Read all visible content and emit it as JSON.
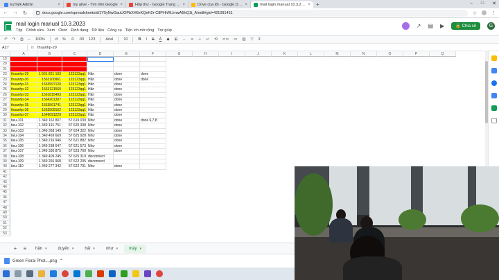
{
  "browser": {
    "tabs": [
      {
        "label": "EzTalk Admin",
        "color": "#4285f4"
      },
      {
        "label": "my alive - Tìm trên Google",
        "color": "#ea4335"
      },
      {
        "label": "Hộp thư - Google Trang tính",
        "color": "#ea4335"
      },
      {
        "label": "Drive của tôi - Google Drive",
        "color": "#fbbc04"
      },
      {
        "label": "mail login manual 10.3.2023 - Go",
        "color": "#0f9d58",
        "active": true
      }
    ],
    "url": "docs.google.com/spreadsheets/d/1Y5yNwGauUOPbXH6xKQeH2r-C8PHhRLlmwA5hQ1t_A/edit#gid=421091451"
  },
  "sheets": {
    "title": "mail login manual 10.3.2023",
    "menus": [
      "Tệp",
      "Chỉnh sửa",
      "Xem",
      "Chèn",
      "Định dạng",
      "Dữ liệu",
      "Công cụ",
      "Tiện ích mở rộng",
      "Trợ giúp"
    ],
    "share_label": "Chia sẻ",
    "account_initial": "G",
    "toolbar": {
      "zoom": "100%",
      "currency": "đ",
      "percent": "%",
      "decimal_less": ".0",
      "decimal_more": ".00",
      "number_format": "123",
      "font": "Arial",
      "font_size": "10"
    },
    "name_box": "A27",
    "formula": "thuanhp-29"
  },
  "grid": {
    "columns": [
      "A",
      "B",
      "C",
      "D",
      "E",
      "F",
      "G",
      "H",
      "I",
      "J",
      "K",
      "L",
      "M",
      "N",
      "O",
      "P",
      "Q"
    ],
    "rows": [
      {
        "n": "19",
        "cells": [
          "",
          "",
          "",
          "",
          "",
          ""
        ],
        "fill": [
          "#ff0000",
          "#ff0000",
          "#ff0000"
        ]
      },
      {
        "n": "20",
        "cells": [
          "",
          "",
          "",
          "",
          "",
          ""
        ],
        "fill": [
          "#ff0000",
          "#ff0000",
          "#ff0000"
        ]
      },
      {
        "n": "21",
        "cells": [
          "",
          "",
          "",
          "",
          "",
          ""
        ],
        "fill": [
          "#ff0000",
          "#ff0000",
          "#ff0000"
        ]
      },
      {
        "n": "22",
        "cells": [
          "thuanhp-29",
          "1 561 821 103",
          "123123qq1",
          "Hân",
          "done",
          "done"
        ],
        "fill": [
          "#ffff00",
          "#ffff00",
          "#ffff00"
        ]
      },
      {
        "n": "23",
        "cells": [
          "thuanhp-30",
          "1563100961",
          "123123qq1",
          "Hân",
          "done",
          "done"
        ],
        "fill": [
          "#ffff00",
          "#ffff00",
          "#ffff00"
        ]
      },
      {
        "n": "24",
        "cells": [
          "thuanhp-31",
          "1563597120",
          "123123qq1",
          "Hân",
          "done",
          ""
        ],
        "fill": [
          "#ffff00",
          "#ffff00",
          "#ffff00"
        ]
      },
      {
        "n": "25",
        "cells": [
          "thuanhp-32",
          "1563121560",
          "123123qq1",
          "Hân",
          "done",
          ""
        ],
        "fill": [
          "#ffff00",
          "#ffff00",
          "#ffff00"
        ]
      },
      {
        "n": "26",
        "cells": [
          "thuanhp-33",
          "1561815493",
          "123123qq1",
          "Hân",
          "done",
          ""
        ],
        "fill": [
          "#ffff00",
          "#ffff00",
          "#ffff00"
        ]
      },
      {
        "n": "27",
        "cells": [
          "thuanhp-34",
          "1564201307",
          "123123qq1",
          "Hân",
          "done",
          ""
        ],
        "fill": [
          "#ffff00",
          "#ffff00",
          "#ffff00"
        ]
      },
      {
        "n": "28",
        "cells": [
          "thuanhp-35",
          "1563561741",
          "123123qq1",
          "Hân",
          "done",
          ""
        ],
        "fill": [
          "#ffff00",
          "#ffff00",
          "#ffff00"
        ]
      },
      {
        "n": "29",
        "cells": [
          "thuanhp-36",
          "1563509162",
          "123123qq1",
          "Hân",
          "done",
          ""
        ],
        "fill": [
          "#ffff00",
          "#ffff00",
          "#ffff00"
        ]
      },
      {
        "n": "30",
        "cells": [
          "thuanhp-37",
          "1549091229",
          "123123qq1",
          "Hân",
          "done",
          ""
        ],
        "fill": [
          "#ffff00",
          "#ffff00",
          "#ffff00"
        ]
      },
      {
        "n": "31",
        "cells": [
          "tieu-101",
          "1 349 162 807",
          "57 619 039",
          "Như",
          "done",
          "done 6,7,8"
        ]
      },
      {
        "n": "32",
        "cells": [
          "tieu-102",
          "1 349 191 751",
          "57 620 338",
          "Như",
          "done",
          ""
        ]
      },
      {
        "n": "33",
        "cells": [
          "tieu-103",
          "1 349 368 149",
          "57 624 322",
          "Như",
          "done",
          ""
        ]
      },
      {
        "n": "34",
        "cells": [
          "tieu-104",
          "1 349 469 669",
          "57 625 928",
          "Như",
          "done",
          ""
        ]
      },
      {
        "n": "35",
        "cells": [
          "tieu-105",
          "1 349 216 946",
          "57 621 882",
          "Như",
          "done",
          ""
        ]
      },
      {
        "n": "36",
        "cells": [
          "tieu-106",
          "1 349 238 647",
          "57 621 573",
          "Như",
          "done",
          ""
        ]
      },
      {
        "n": "37",
        "cells": [
          "tieu-107",
          "1 349 330 875",
          "57 523 760",
          "Như",
          "done",
          ""
        ]
      },
      {
        "n": "38",
        "cells": [
          "tieu-108",
          "1 349 409 245",
          "57 625 319",
          "disconnect",
          "",
          ""
        ]
      },
      {
        "n": "39",
        "cells": [
          "tieu-109",
          "1 349 266 968",
          "57 622 205",
          "disconnect",
          "",
          ""
        ]
      },
      {
        "n": "40",
        "cells": [
          "tieu-110",
          "1 349 277 342",
          "57 622 791",
          "Như",
          "done",
          ""
        ]
      }
    ],
    "empty_rows": [
      "41",
      "42",
      "43",
      "44",
      "45",
      "46",
      "47",
      "48",
      "49",
      "50",
      "51",
      "52",
      "53"
    ]
  },
  "sheet_tabs": [
    {
      "label": "hân",
      "active": false
    },
    {
      "label": "duyên",
      "active": false
    },
    {
      "label": "hải",
      "active": false
    },
    {
      "label": "như",
      "active": false
    },
    {
      "label": "máy",
      "active": true
    }
  ],
  "download": {
    "filename": "Green Floral Phot....png"
  },
  "colors": {
    "accent": "#1e8e3e",
    "red_fill": "#ff0000",
    "yellow_fill": "#ffff00"
  }
}
